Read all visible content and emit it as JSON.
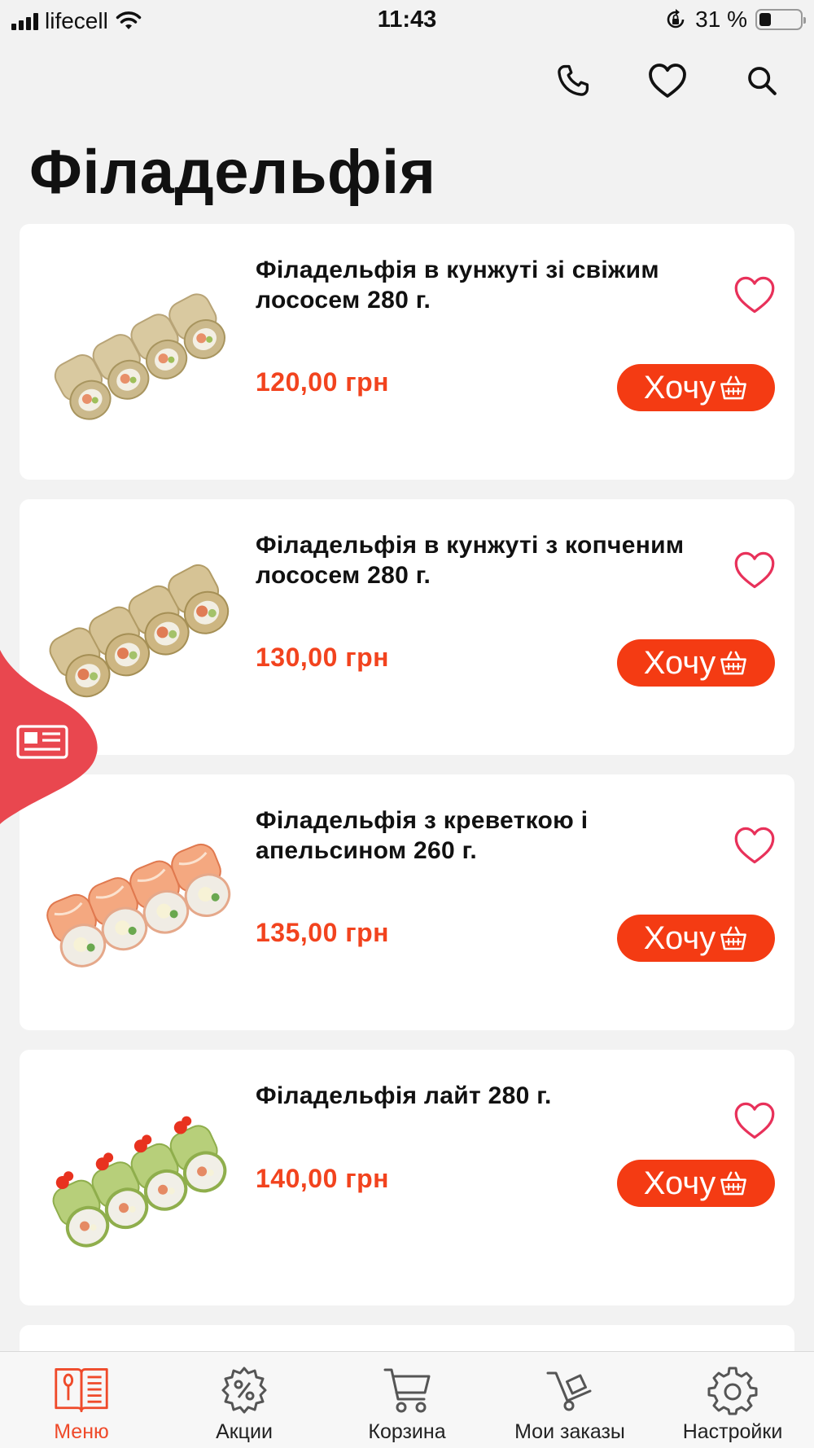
{
  "status_bar": {
    "carrier": "lifecell",
    "time": "11:43",
    "battery": "31 %"
  },
  "header": {
    "title": "Філадельфія",
    "icons": [
      "phone-icon",
      "heart-icon",
      "search-icon"
    ]
  },
  "products": [
    {
      "name": "Філадельфія в кунжуті зі свіжим лососем 280 г.",
      "price": "120,00 грн",
      "button": "Хочу",
      "roll": "sesame"
    },
    {
      "name": "Філадельфія в кунжуті з копченим лососем 280 г.",
      "price": "130,00 грн",
      "button": "Хочу",
      "roll": "sesame"
    },
    {
      "name": "Філадельфія з креветкою і апельсином 260 г.",
      "price": "135,00 грн",
      "button": "Хочу",
      "roll": "shrimp"
    },
    {
      "name": "Філадельфія лайт 280 г.",
      "price": "140,00 грн",
      "button": "Хочу",
      "roll": "cucumber"
    }
  ],
  "tab_bar": {
    "items": [
      {
        "label": "Меню",
        "icon": "menu-book-icon",
        "active": true
      },
      {
        "label": "Акции",
        "icon": "discount-gear-icon",
        "active": false
      },
      {
        "label": "Корзина",
        "icon": "cart-icon",
        "active": false
      },
      {
        "label": "Мои заказы",
        "icon": "orders-trolley-icon",
        "active": false
      },
      {
        "label": "Настройки",
        "icon": "settings-gear-icon",
        "active": false
      }
    ]
  },
  "colors": {
    "accent": "#f43b13",
    "price": "#f2431e",
    "heart": "#e8315a",
    "side_tab": "#e9474f"
  }
}
